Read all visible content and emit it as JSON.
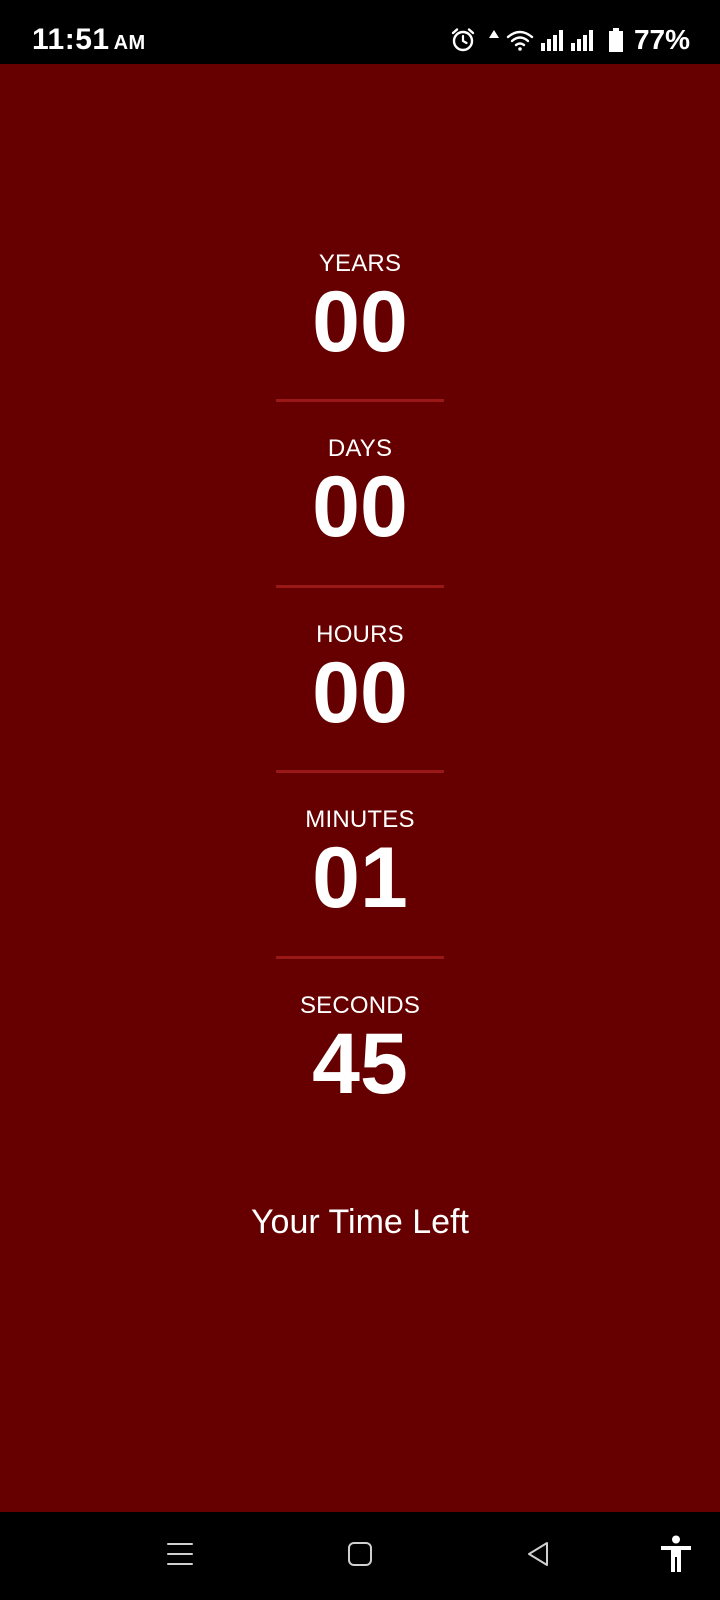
{
  "status_bar": {
    "time": "11:51",
    "ampm": "AM",
    "battery_percent": "77%",
    "icons": [
      "alarm-icon",
      "data-arrow-icon",
      "wifi-icon",
      "signal-icon",
      "signal-icon",
      "battery-icon"
    ]
  },
  "countdown": {
    "units": [
      {
        "label": "YEARS",
        "value": "00"
      },
      {
        "label": "DAYS",
        "value": "00"
      },
      {
        "label": "HOURS",
        "value": "00"
      },
      {
        "label": "MINUTES",
        "value": "01"
      },
      {
        "label": "SECONDS",
        "value": "45"
      }
    ],
    "caption": "Your Time Left"
  },
  "nav_bar": {
    "icons": [
      "recent-apps-icon",
      "home-icon",
      "back-icon",
      "accessibility-icon"
    ]
  },
  "colors": {
    "background": "#660000",
    "divider": "#9a1818",
    "text": "#ffffff",
    "system_bars": "#000000"
  }
}
